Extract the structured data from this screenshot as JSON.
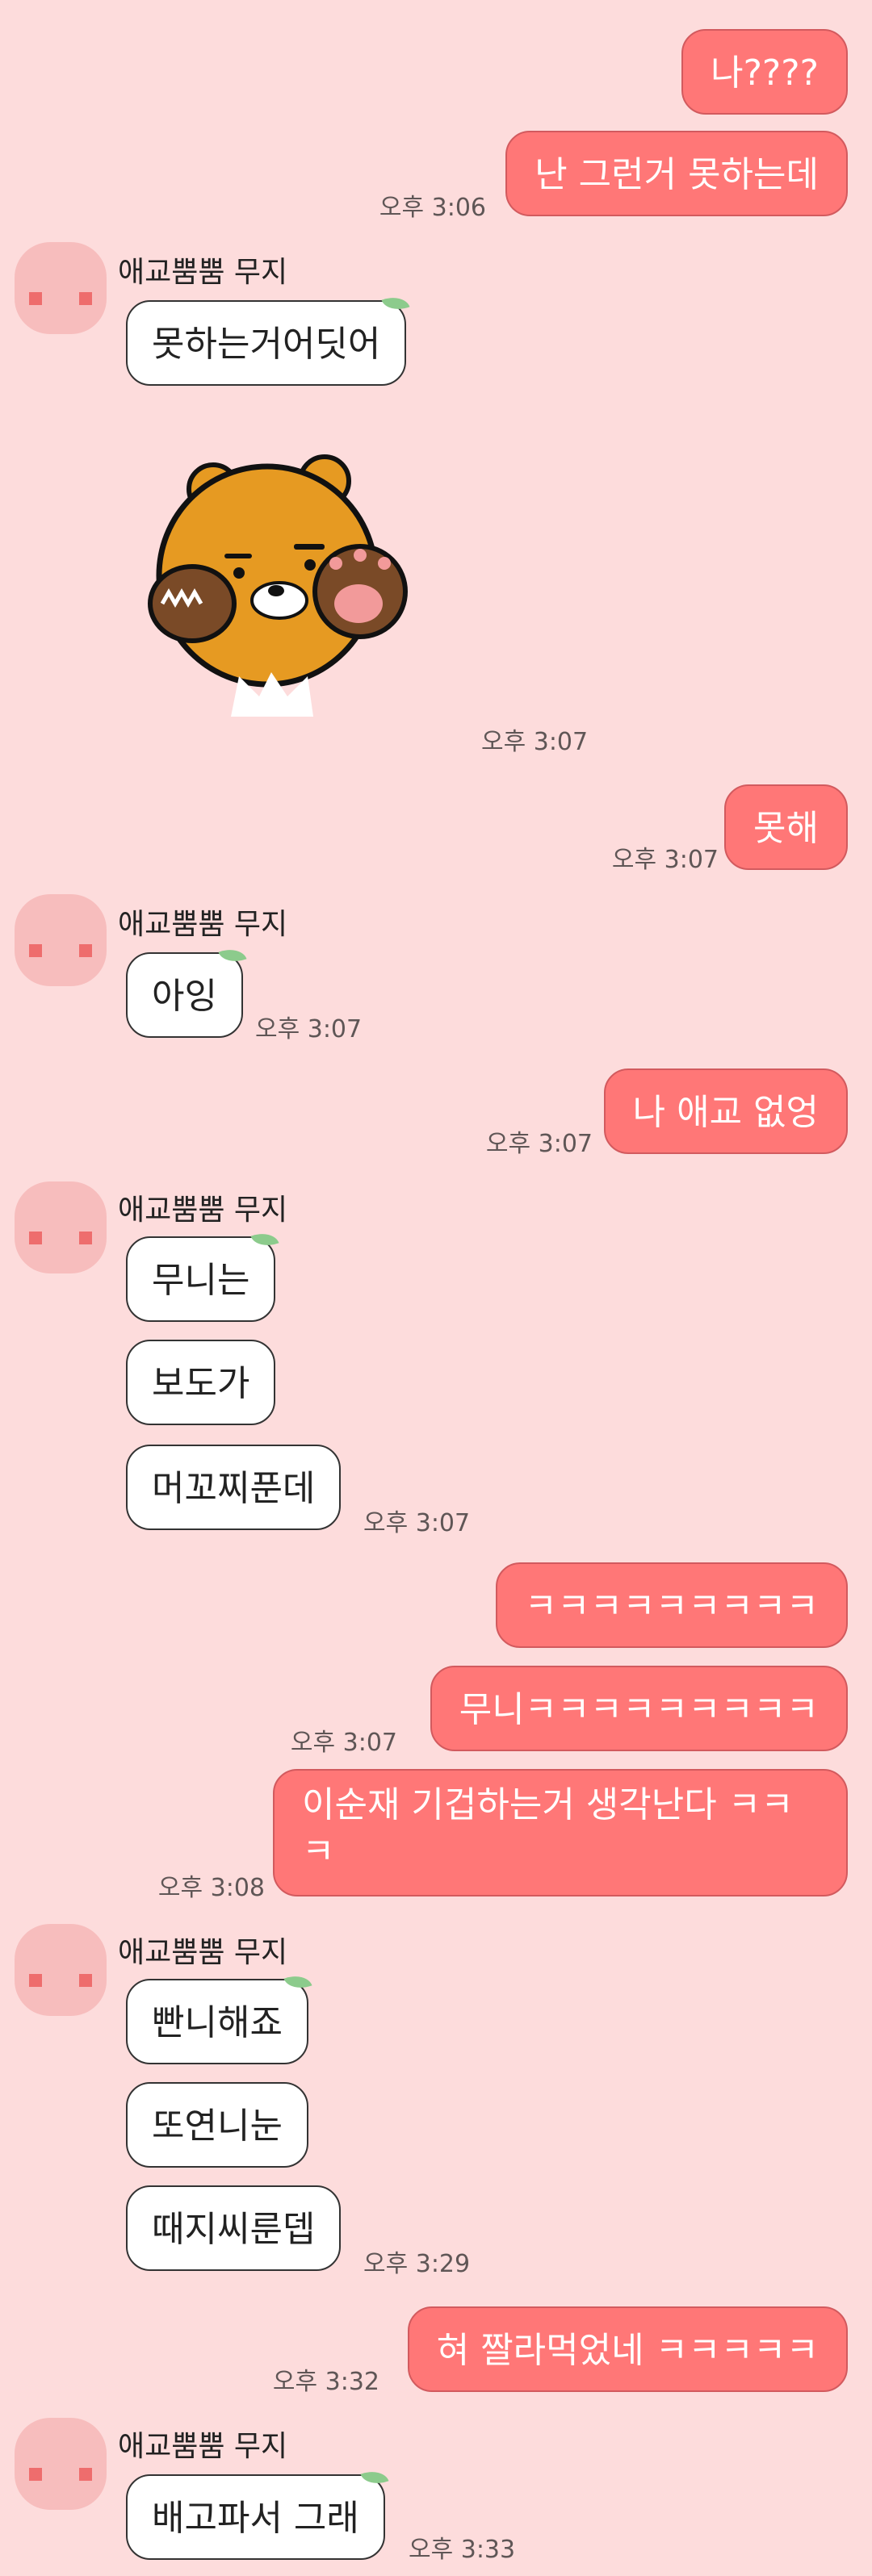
{
  "contact": {
    "name": "애교뿜뿜 무지"
  },
  "colors": {
    "background": "#FDDCDC",
    "sent_bubble": "#FF7777",
    "received_bubble": "#FFFFFF",
    "avatar": "#F7BDBD"
  },
  "sticker": {
    "icon": "ryan-bear-sticker-icon",
    "time": "오후 3:07"
  },
  "messages": [
    {
      "dir": "out",
      "text": "나????",
      "time": ""
    },
    {
      "dir": "out",
      "text": "난 그런거 못하는데",
      "time": "오후 3:06"
    },
    {
      "dir": "in",
      "text": "못하는거어딧어",
      "time": ""
    },
    {
      "dir": "out",
      "text": "못해",
      "time": "오후 3:07"
    },
    {
      "dir": "in",
      "text": "아잉",
      "time": "오후 3:07"
    },
    {
      "dir": "out",
      "text": "나 애교 없엉",
      "time": "오후 3:07"
    },
    {
      "dir": "in",
      "text": "무니는",
      "time": ""
    },
    {
      "dir": "in",
      "text": "보도가",
      "time": ""
    },
    {
      "dir": "in",
      "text": "머꼬찌푼데",
      "time": "오후 3:07"
    },
    {
      "dir": "out",
      "text": "ㅋㅋㅋㅋㅋㅋㅋㅋㅋ",
      "time": ""
    },
    {
      "dir": "out",
      "text": "무니ㅋㅋㅋㅋㅋㅋㅋㅋㅋ",
      "time": "오후 3:07"
    },
    {
      "dir": "out",
      "text": "이순재 기겁하는거 생각난다 ㅋㅋㅋ",
      "time": "오후 3:08"
    },
    {
      "dir": "in",
      "text": "빤니해죠",
      "time": ""
    },
    {
      "dir": "in",
      "text": "또연니눈",
      "time": ""
    },
    {
      "dir": "in",
      "text": "때지씨룬뎁",
      "time": "오후 3:29"
    },
    {
      "dir": "out",
      "text": "혀 짤라먹었네 ㅋㅋㅋㅋㅋ",
      "time": "오후 3:32"
    },
    {
      "dir": "in",
      "text": "배고파서 그래",
      "time": "오후 3:33"
    }
  ]
}
